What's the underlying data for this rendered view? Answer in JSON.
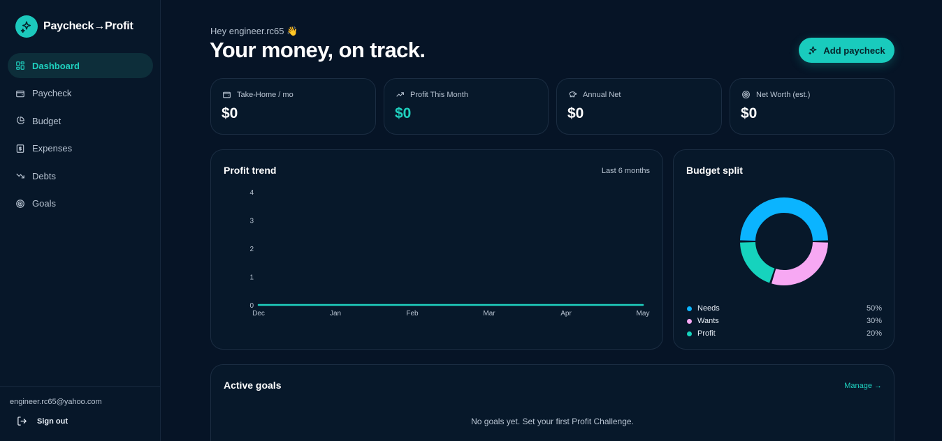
{
  "brand": {
    "name": "Paycheck→Profit"
  },
  "sidebar": {
    "items": [
      {
        "label": "Dashboard",
        "icon": "grid-icon",
        "active": true
      },
      {
        "label": "Paycheck",
        "icon": "wallet-icon"
      },
      {
        "label": "Budget",
        "icon": "pie-icon"
      },
      {
        "label": "Expenses",
        "icon": "receipt-icon"
      },
      {
        "label": "Debts",
        "icon": "trending-down-icon"
      },
      {
        "label": "Goals",
        "icon": "target-icon"
      }
    ],
    "user_email": "engineer.rc65@yahoo.com",
    "signout_label": "Sign out"
  },
  "header": {
    "greeting": "Hey engineer.rc65 👋",
    "title": "Your money, on track.",
    "add_button": "Add paycheck"
  },
  "stats": [
    {
      "label": "Take-Home / mo",
      "value": "$0",
      "icon": "wallet-icon"
    },
    {
      "label": "Profit This Month",
      "value": "$0",
      "icon": "trending-up-icon",
      "accent": "#1fd0bf"
    },
    {
      "label": "Annual Net",
      "value": "$0",
      "icon": "piggy-bank-icon"
    },
    {
      "label": "Net Worth (est.)",
      "value": "$0",
      "icon": "target-icon"
    }
  ],
  "profit_trend": {
    "title": "Profit trend",
    "subtitle": "Last 6 months"
  },
  "budget_split": {
    "title": "Budget split"
  },
  "goals": {
    "title": "Active goals",
    "manage_link": "Manage →",
    "empty_text": "No goals yet. Set your first Profit Challenge."
  },
  "chart_data": [
    {
      "type": "line",
      "x": [
        "Dec",
        "Jan",
        "Feb",
        "Mar",
        "Apr",
        "May"
      ],
      "series": [
        {
          "values": [
            0,
            0,
            0,
            0,
            0,
            0
          ],
          "color": "#1fd0bf"
        }
      ],
      "yticks": [
        0,
        1,
        2,
        3,
        4
      ],
      "ylim": [
        0,
        4
      ]
    },
    {
      "type": "pie",
      "categories": [
        "Needs",
        "Wants",
        "Profit"
      ],
      "values": [
        50,
        30,
        20
      ],
      "labels": [
        "50%",
        "30%",
        "20%"
      ],
      "colors": [
        "#0bb4ff",
        "#f7a8f3",
        "#16d3bd"
      ]
    }
  ]
}
